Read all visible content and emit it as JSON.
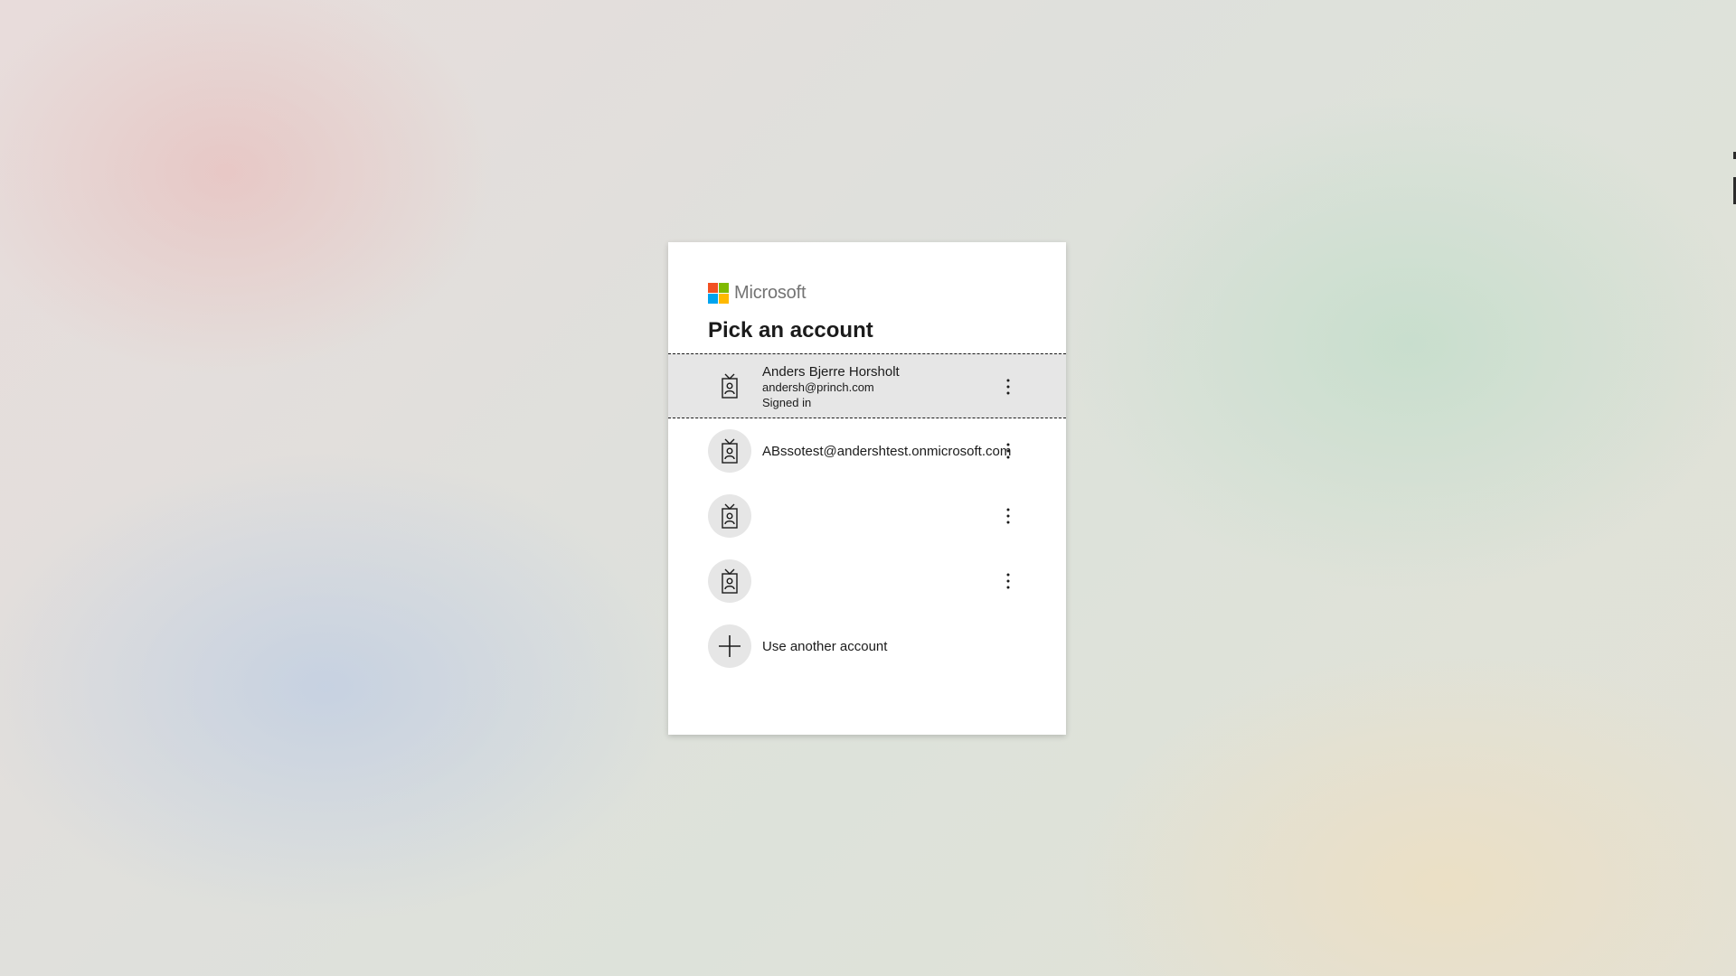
{
  "brand": {
    "name": "Microsoft",
    "logo_colors": [
      "#f25022",
      "#7fba00",
      "#00a4ef",
      "#ffb900"
    ]
  },
  "title": "Pick an account",
  "accounts": [
    {
      "name": "Anders Bjerre Horsholt",
      "email": "andersh@princh.com",
      "status": "Signed in",
      "selected": true,
      "icon": "work-account-badge-icon"
    },
    {
      "email": "ABssotest@andershtest.onmicrosoft.com",
      "selected": false,
      "icon": "work-account-badge-icon"
    },
    {
      "selected": false,
      "icon": "work-account-badge-icon"
    },
    {
      "selected": false,
      "icon": "work-account-badge-icon"
    }
  ],
  "use_another": {
    "label": "Use another account",
    "icon": "plus-icon"
  },
  "more_options_icon": "more-vertical-icon"
}
